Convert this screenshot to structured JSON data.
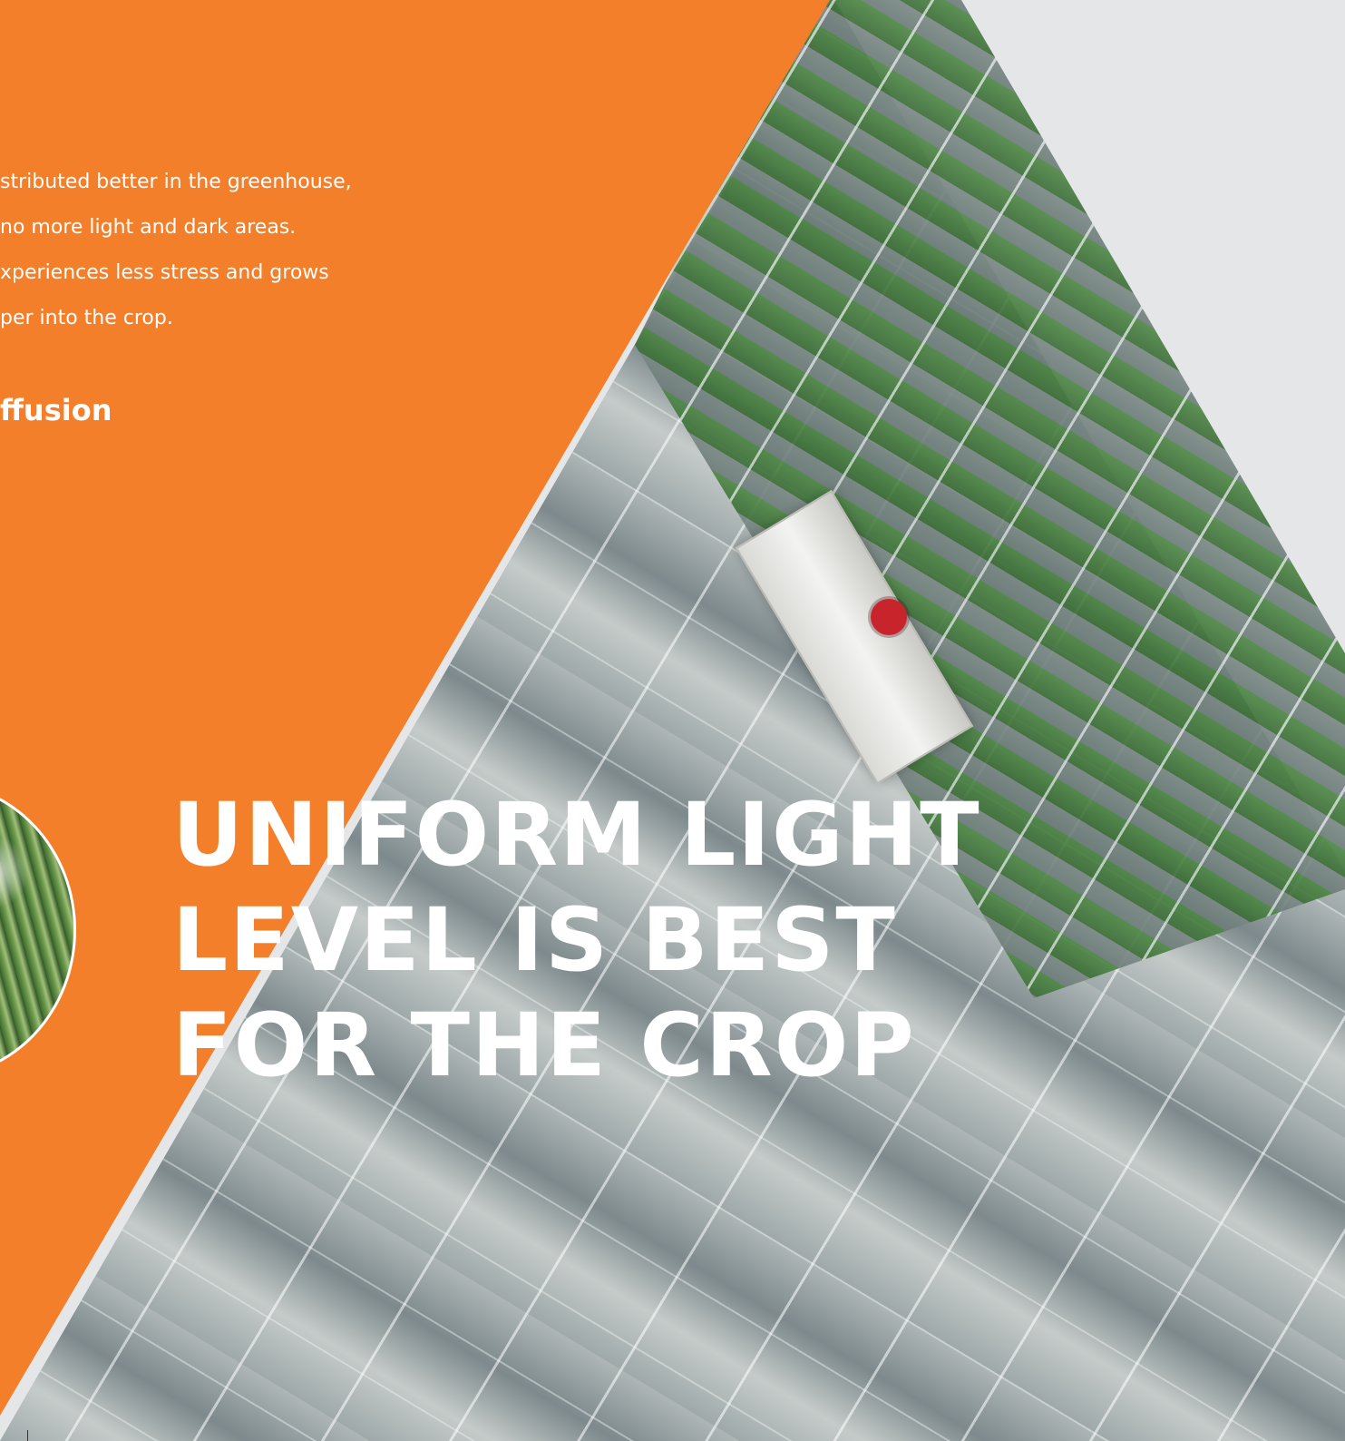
{
  "body_text": {
    "line1": "stributed better in the greenhouse,",
    "line2": "no more light and dark areas.",
    "line3": "xperiences less stress and grows",
    "line4": "per into the crop."
  },
  "subheading": "ffusion",
  "headline": {
    "line1": "UNIFORM LIGHT",
    "line2": "LEVEL IS BEST",
    "line3": "FOR THE CROP"
  },
  "colors": {
    "accent_orange": "#f47f2a",
    "background": "#e5e6e8",
    "text": "#ffffff"
  }
}
